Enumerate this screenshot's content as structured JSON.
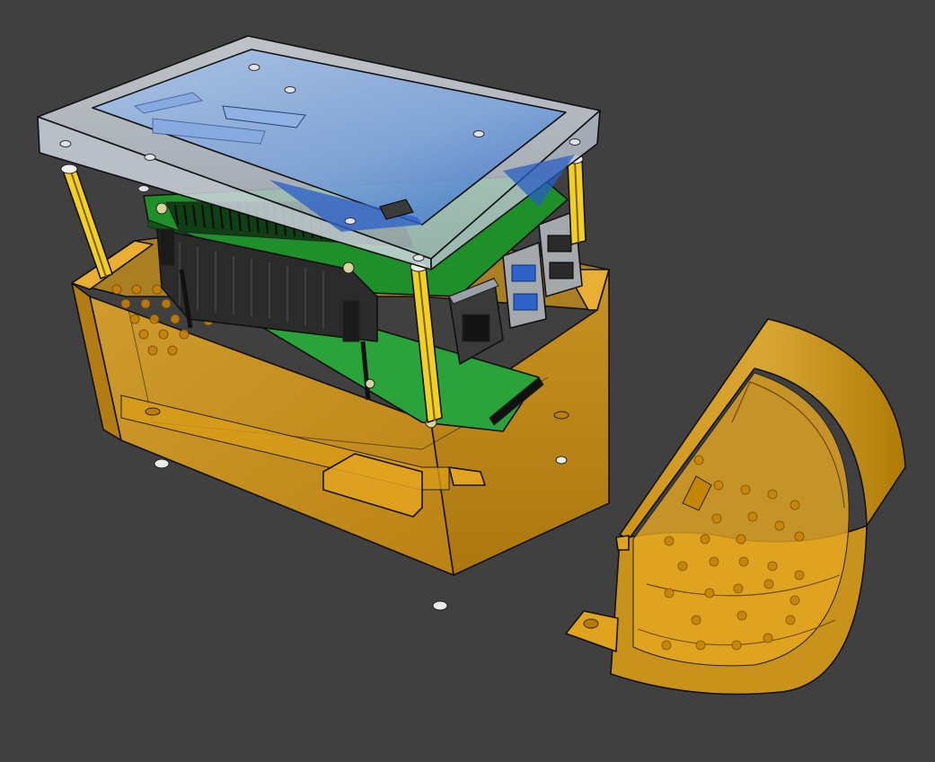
{
  "viewport": {
    "background_color": "#404040"
  },
  "model": {
    "parts": [
      {
        "name": "display-panel",
        "icon": "lcd-screen",
        "color": "#6f9bd6"
      },
      {
        "name": "display-bezel",
        "icon": "frame",
        "color": "#c6d0dc"
      },
      {
        "name": "single-board-computer",
        "icon": "pcb",
        "color": "#1f8f2a"
      },
      {
        "name": "enclosure-base",
        "icon": "box",
        "color": "#e3a31a"
      },
      {
        "name": "enclosure-end-cap",
        "icon": "half-cylinder",
        "color": "#e3a31a"
      },
      {
        "name": "standoffs",
        "icon": "pillar",
        "color": "#f2cf22"
      }
    ],
    "colors": {
      "amber_transparent": "#e3a31a",
      "amber_edge": "#7a5200",
      "pcb_green": "#1f8f2a",
      "pcb_dark": "#0c5a14",
      "usb_blue": "#2e63c9",
      "metal": "#a4a9ae",
      "screen_blue": "#5d8fd8",
      "standoff_yellow": "#f2cf22"
    }
  }
}
